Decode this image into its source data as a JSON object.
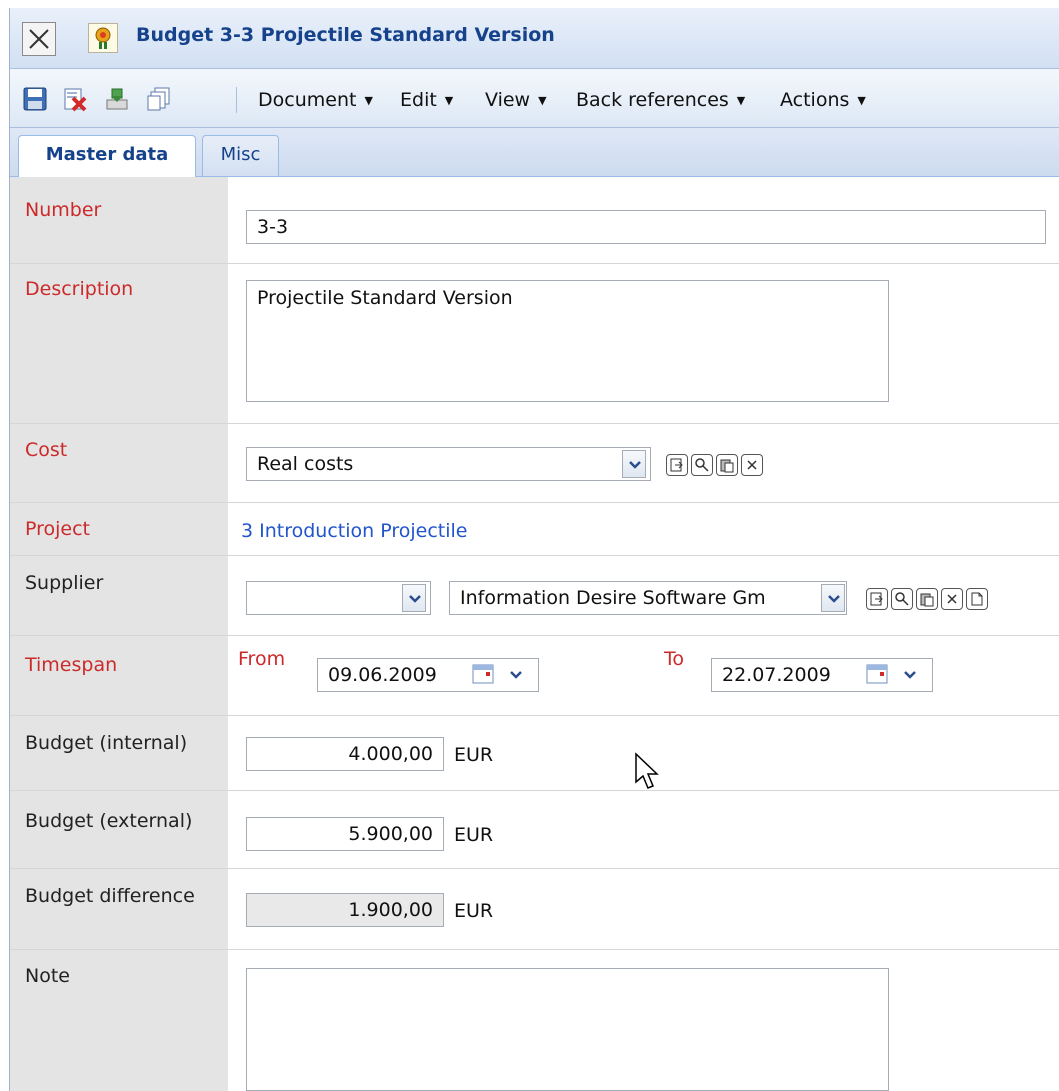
{
  "window": {
    "title": "Budget 3-3 Projectile Standard Version"
  },
  "toolbar": {
    "icons": [
      "save-icon",
      "delete-icon",
      "export-icon",
      "copy-icon"
    ],
    "menus": [
      "Document",
      "Edit",
      "View",
      "Back references",
      "Actions"
    ]
  },
  "tabs": [
    "Master data",
    "Misc"
  ],
  "form": {
    "number": {
      "label": "Number",
      "value": "3-3"
    },
    "description": {
      "label": "Description",
      "value": "Projectile Standard Version"
    },
    "cost": {
      "label": "Cost",
      "value": "Real costs"
    },
    "project": {
      "label": "Project",
      "value": "3 Introduction Projectile"
    },
    "supplier": {
      "label": "Supplier",
      "value_left": "",
      "value_right": "Information Desire Software Gm"
    },
    "timespan": {
      "label": "Timespan",
      "from_label": "From",
      "from_value": "09.06.2009",
      "to_label": "To",
      "to_value": "22.07.2009"
    },
    "budget_internal": {
      "label": "Budget (internal)",
      "value": "4.000,00",
      "unit": "EUR"
    },
    "budget_external": {
      "label": "Budget (external)",
      "value": "5.900,00",
      "unit": "EUR"
    },
    "budget_difference": {
      "label": "Budget difference",
      "value": "1.900,00",
      "unit": "EUR"
    },
    "note": {
      "label": "Note",
      "value": ""
    }
  },
  "colors": {
    "required_label": "#cc2a2a",
    "title": "#15428b",
    "link": "#2255cc",
    "label_column_bg": "#e4e4e4"
  }
}
